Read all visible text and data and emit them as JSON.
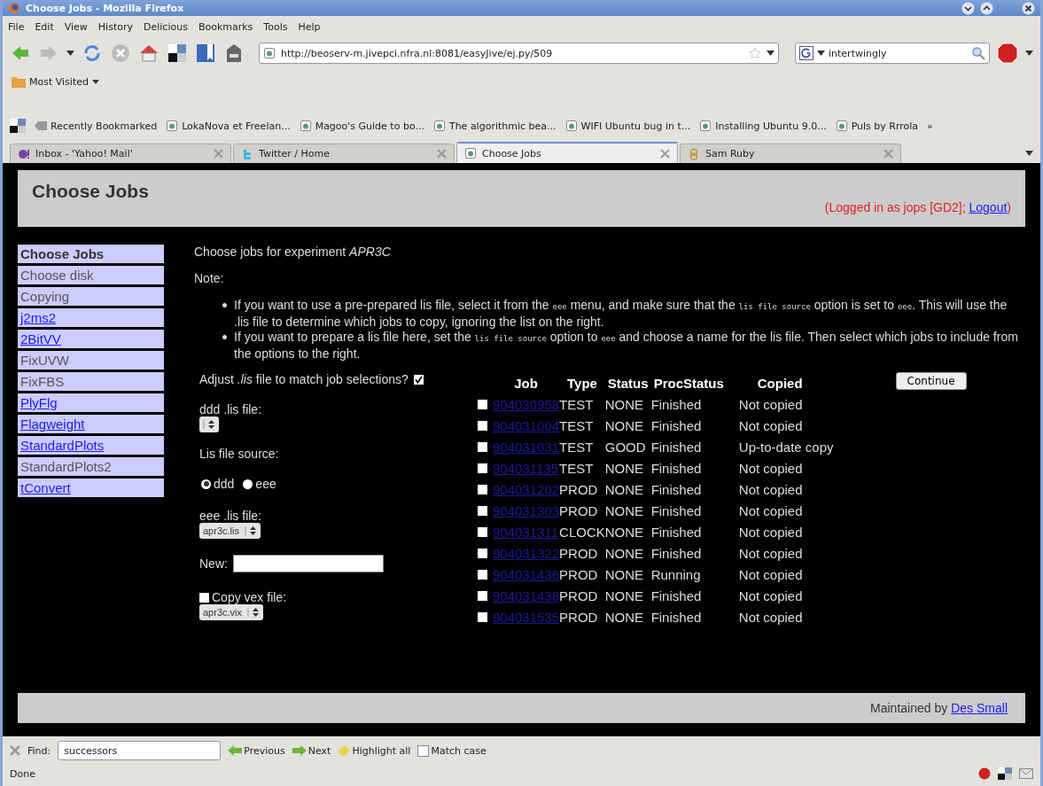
{
  "window": {
    "title": "Choose Jobs - Mozilla Firefox"
  },
  "menu": [
    "File",
    "Edit",
    "View",
    "History",
    "Delicious",
    "Bookmarks",
    "Tools",
    "Help"
  ],
  "address_bar": {
    "value": "http://beoserv-m.jivepci.nfra.nl:8081/easyJive/ej.py/509"
  },
  "search_bar": {
    "value": "intertwingly"
  },
  "most_visited": "Most Visited",
  "bookmarks": [
    "Recently Bookmarked",
    "LokaNova et Freelan...",
    "Magoo's Guide to bo...",
    "The algorithmic bea...",
    "WIFI Ubuntu bug in t...",
    "Installing Ubuntu 9.0...",
    "Puls by Rrrola",
    "»"
  ],
  "tabs": [
    {
      "label": "Inbox - 'Yahoo! Mail'",
      "selected": false
    },
    {
      "label": "Twitter / Home",
      "selected": false
    },
    {
      "label": "Choose Jobs",
      "selected": true
    },
    {
      "label": "Sam Ruby",
      "selected": false
    }
  ],
  "page": {
    "title": "Choose Jobs",
    "login": {
      "text": "(Logged in as jops [GD2];",
      "link": "Logout",
      "close": ")"
    },
    "sidebar": [
      {
        "label": "Choose Jobs",
        "selected": true,
        "link": false
      },
      {
        "label": "Choose disk",
        "selected": false,
        "link": false
      },
      {
        "label": "Copying",
        "selected": false,
        "link": false
      },
      {
        "label": "j2ms2",
        "selected": false,
        "link": true
      },
      {
        "label": "2BitVV",
        "selected": false,
        "link": true
      },
      {
        "label": "FixUVW",
        "selected": false,
        "link": false
      },
      {
        "label": "FixFBS",
        "selected": false,
        "link": false
      },
      {
        "label": "PlyFlg",
        "selected": false,
        "link": true
      },
      {
        "label": "Flagweight",
        "selected": false,
        "link": true
      },
      {
        "label": "StandardPlots",
        "selected": false,
        "link": true
      },
      {
        "label": "StandardPlots2",
        "selected": false,
        "link": false
      },
      {
        "label": "tConvert",
        "selected": false,
        "link": true
      }
    ],
    "intro": "Choose jobs for experiment *APR3C*",
    "note": "Note:",
    "bullets": [
      [
        {
          "text": "If you want to use a pre-prepared lis file, select it from the ",
          "mono": false
        },
        {
          "text": "eee",
          "mono": true
        },
        {
          "text": " menu, and make sure that the ",
          "mono": false
        },
        {
          "text": "lis file source",
          "mono": true
        },
        {
          "text": " option is set to ",
          "mono": false
        },
        {
          "text": "eee",
          "mono": true
        },
        {
          "text": ". This will use the .lis file to determine which jobs to copy, ignoring the list on the right.",
          "mono": false
        }
      ],
      [
        {
          "text": "If you want to prepare a lis file here, set the ",
          "mono": false
        },
        {
          "text": "lis file source",
          "mono": true
        },
        {
          "text": " option to ",
          "mono": false
        },
        {
          "text": "eee",
          "mono": true
        },
        {
          "text": " and choose a name for the lis file. Then select which jobs to include from the options to the right.",
          "mono": false
        }
      ]
    ],
    "adjust": {
      "label": "Adjust *.lis* file to match job selections?",
      "checked": true
    },
    "ddd_lis": {
      "label": "ddd .lis file:"
    },
    "source": {
      "label": "Lis file source:",
      "options": [
        {
          "label": "ddd",
          "selected": true
        },
        {
          "label": "eee",
          "selected": false
        }
      ]
    },
    "eee_lis": {
      "label": "eee .lis file:",
      "value": "apr3c.lis"
    },
    "new": {
      "label": "New:"
    },
    "copy_vex": {
      "label": "Copy vex file:",
      "checked": false,
      "value": "apr3c.vix"
    },
    "table": {
      "columns": [
        "Job",
        "Type",
        "Status",
        "ProcStatus",
        "Copied"
      ],
      "rows": [
        {
          "checked": false,
          "job": "904030958",
          "type": "TEST",
          "status": "NONE",
          "proc_status": "Finished",
          "copied": "Not copied"
        },
        {
          "checked": false,
          "job": "904031004",
          "type": "TEST",
          "status": "NONE",
          "proc_status": "Finished",
          "copied": "Not copied"
        },
        {
          "checked": false,
          "job": "904031031",
          "type": "TEST",
          "status": "GOOD",
          "proc_status": "Finished",
          "copied": "Up-to-date copy"
        },
        {
          "checked": false,
          "job": "904031135",
          "type": "TEST",
          "status": "NONE",
          "proc_status": "Finished",
          "copied": "Not copied"
        },
        {
          "checked": false,
          "job": "904031202",
          "type": "PROD",
          "status": "NONE",
          "proc_status": "Finished",
          "copied": "Not copied"
        },
        {
          "checked": false,
          "job": "904031303",
          "type": "PROD",
          "status": "NONE",
          "proc_status": "Finished",
          "copied": "Not copied"
        },
        {
          "checked": false,
          "job": "904031311",
          "type": "CLOCK",
          "status": "NONE",
          "proc_status": "Finished",
          "copied": "Not copied"
        },
        {
          "checked": false,
          "job": "904031322",
          "type": "PROD",
          "status": "NONE",
          "proc_status": "Finished",
          "copied": "Not copied"
        },
        {
          "checked": false,
          "job": "904031436",
          "type": "PROD",
          "status": "NONE",
          "proc_status": "Running",
          "copied": "Not copied"
        },
        {
          "checked": false,
          "job": "904031438",
          "type": "PROD",
          "status": "NONE",
          "proc_status": "Finished",
          "copied": "Not copied"
        },
        {
          "checked": false,
          "job": "904031535",
          "type": "PROD",
          "status": "NONE",
          "proc_status": "Finished",
          "copied": "Not copied"
        }
      ]
    },
    "continue_button": "Continue",
    "footer": {
      "text": "Maintained by",
      "link": "Des Small"
    }
  },
  "find_bar": {
    "label": "Find:",
    "value": "successors",
    "previous": "Previous",
    "next": "Next",
    "highlight": "Highlight all",
    "match_case": {
      "label": "Match case",
      "checked": false
    }
  },
  "status_bar": "Done"
}
